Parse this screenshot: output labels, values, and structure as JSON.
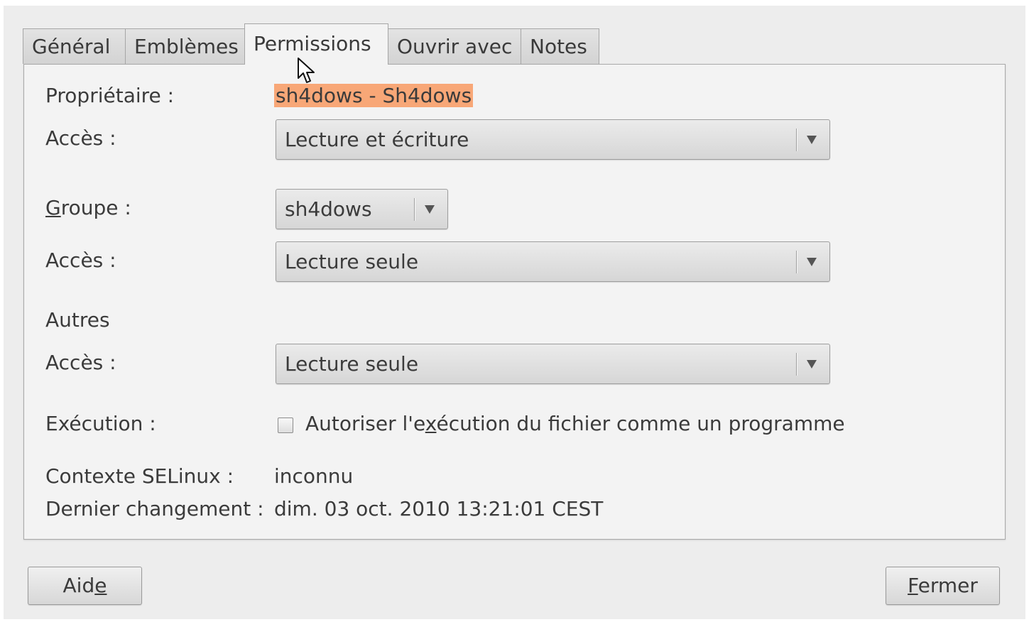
{
  "tabs": [
    {
      "label": "Général"
    },
    {
      "label": "Emblèmes"
    },
    {
      "label": "Permissions"
    },
    {
      "label": "Ouvrir avec"
    },
    {
      "label": "Notes"
    }
  ],
  "active_tab": "Permissions",
  "owner": {
    "label": "Propriétaire :",
    "value": "sh4dows - Sh4dows",
    "access_label": "Accès :",
    "access_value": "Lecture et écriture"
  },
  "group": {
    "label_mnemonic": "G",
    "label_rest": "roupe :",
    "value": "sh4dows",
    "access_label": "Accès :",
    "access_value": "Lecture seule"
  },
  "others": {
    "label": "Autres",
    "access_label": "Accès :",
    "access_value": "Lecture seule"
  },
  "execution": {
    "label": "Exécution :",
    "checkbox_before": "Autoriser l'e",
    "checkbox_mnemonic": "x",
    "checkbox_after": "écution du fichier comme un programme",
    "checked": false
  },
  "selinux": {
    "label": "Contexte SELinux :",
    "value": "inconnu"
  },
  "last_change": {
    "label": "Dernier changement :",
    "value": "dim. 03 oct. 2010 13:21:01 CEST"
  },
  "buttons": {
    "help_before": "Aid",
    "help_mnemonic": "e",
    "close_mnemonic": "F",
    "close_after": "ermer"
  },
  "colors": {
    "owner_highlight": "#f8a777",
    "panel_background": "#f3f3f3",
    "window_background": "#ededed"
  }
}
